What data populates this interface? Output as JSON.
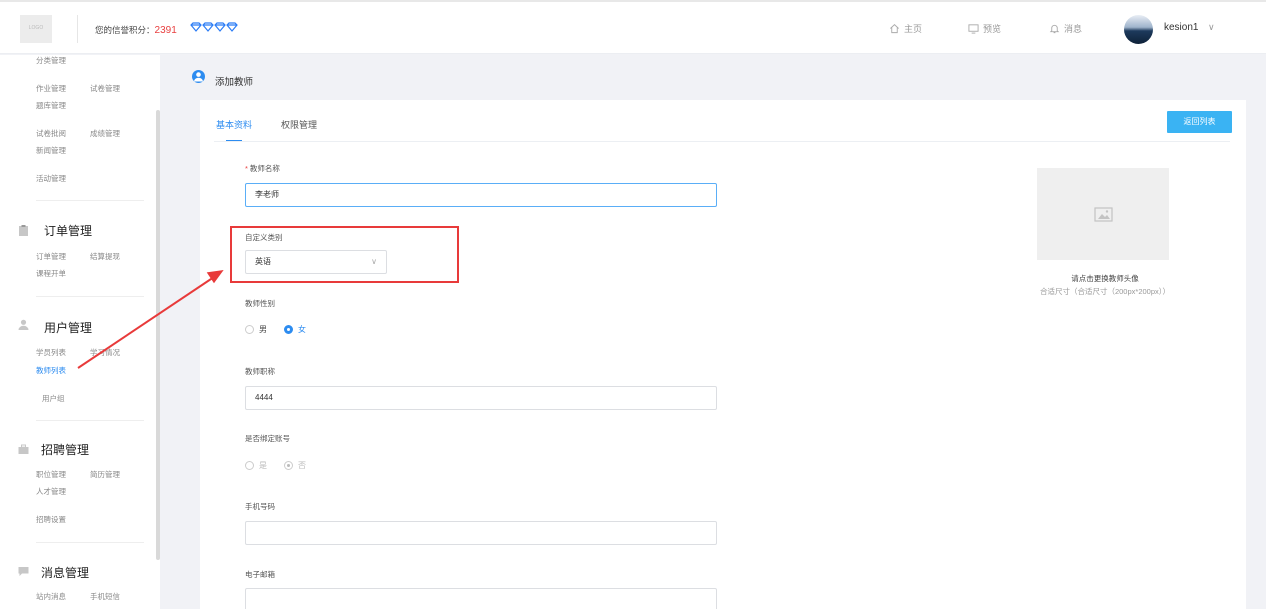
{
  "header": {
    "logo_text": "LOGO",
    "credit_label": "您的信誉积分：",
    "credit_value": "2391",
    "gems": "💎💎💎💎",
    "nav": [
      {
        "label": "主页",
        "icon": "home-icon"
      },
      {
        "label": "预览",
        "icon": "monitor-icon"
      },
      {
        "label": "消息",
        "icon": "bell-icon"
      }
    ],
    "username": "kesion1",
    "user_chevron": "∨"
  },
  "sidebar": {
    "top_items": [
      "分类管理",
      "作业管理",
      "试卷管理",
      "题库管理",
      "试卷批阅",
      "成绩管理",
      "新闻管理",
      "活动管理"
    ],
    "sections": [
      {
        "title": "订单管理",
        "icon": "clipboard-icon",
        "items": [
          "订单管理",
          "结算提现",
          "课程开单"
        ]
      },
      {
        "title": "用户管理",
        "icon": "user-icon",
        "items": [
          "学员列表",
          "学习情况",
          "教师列表",
          "用户组"
        ]
      },
      {
        "title": "招聘管理",
        "icon": "briefcase-icon",
        "items": [
          "职位管理",
          "简历管理",
          "人才管理",
          "招聘设置"
        ]
      },
      {
        "title": "消息管理",
        "icon": "chat-icon",
        "items": [
          "站内消息",
          "手机短信"
        ]
      }
    ]
  },
  "page": {
    "title": "添加教师"
  },
  "tabs": [
    {
      "label": "基本资料",
      "active": true
    },
    {
      "label": "权限管理",
      "active": false
    }
  ],
  "return_button": "返回列表",
  "form": {
    "required_mark": "*",
    "name_label": "教师名称",
    "name_value": "李老师",
    "category_label": "自定义类别",
    "category_value": "英语",
    "gender_label": "教师性别",
    "gender_options": [
      "男",
      "女"
    ],
    "gender_selected": "女",
    "title_label": "教师职称",
    "title_value": "4444",
    "bind_label": "是否绑定账号",
    "bind_options": [
      "是",
      "否"
    ],
    "bind_selected": "否",
    "phone_label": "手机号码",
    "phone_value": "",
    "email_label": "电子邮箱",
    "email_value": ""
  },
  "avatar": {
    "caption": "请点击更换教师头像",
    "size_hint": "合适尺寸（合适尺寸（200px*200px））"
  },
  "colors": {
    "accent": "#2d8cf0",
    "button": "#3ab3f3",
    "highlight": "#e83a3a",
    "credit": "#e84040"
  }
}
